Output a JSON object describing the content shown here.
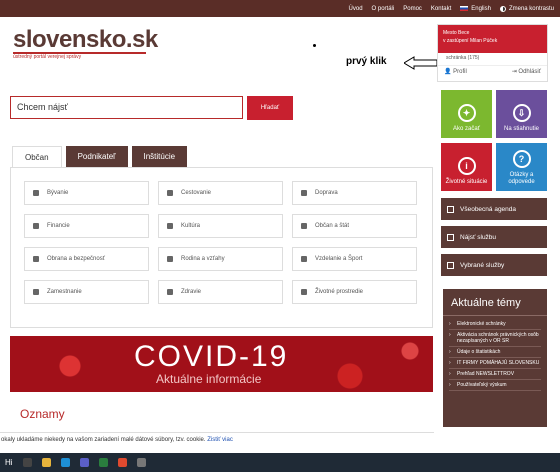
{
  "topbar": {
    "links": [
      "Úvod",
      "O portáli",
      "Pomoc",
      "Kontakt",
      "English",
      "Zmena kontrastu"
    ]
  },
  "logo": {
    "word": "slovensko.sk",
    "tagline": "ústredný portál verejnej správy"
  },
  "annotation": {
    "text": "prvý klik"
  },
  "user": {
    "line1": "Mesto Bece",
    "line2": "v zastúpení Milan Púček",
    "inbox": "schránka (175)",
    "profile": "Profil",
    "logout": "Odhlásiť"
  },
  "search": {
    "placeholder": "Chcem nájsť",
    "button": "Hľadať"
  },
  "tabs": [
    "Občan",
    "Podnikateľ",
    "Inštitúcie"
  ],
  "categories": [
    "Bývanie",
    "Cestovanie",
    "Doprava",
    "Financie",
    "Kultúra",
    "Občan a štát",
    "Obrana a bezpečnosť",
    "Rodina a vzťahy",
    "Vzdelanie a Šport",
    "Zamestnanie",
    "Zdravie",
    "Životné prostredie"
  ],
  "covid": {
    "title": "COVID-19",
    "subtitle": "Aktuálne informácie"
  },
  "oznamy": "Oznamy",
  "tiles": [
    {
      "label": "Ako začať",
      "color": "#7cb82f",
      "glyph": "💡"
    },
    {
      "label": "Na stiahnutie",
      "color": "#6b4f9c",
      "glyph": "⇩"
    },
    {
      "label": "Životné situácie",
      "color": "#c8202f",
      "glyph": "i"
    },
    {
      "label": "Otázky a odpovede",
      "color": "#2a88c8",
      "glyph": "?"
    }
  ],
  "sidebar_buttons": [
    "Všeobecná agenda",
    "Nájsť službu",
    "Vybrané služby"
  ],
  "topics": {
    "title": "Aktuálne témy",
    "items": [
      "Elektronické schránky",
      "Aktivácia schránok právnických osôb nezapísaných v OR SR",
      "Údaje o štatistikách",
      "IT FIRMY POMÁHAJÚ SLOVENSKU",
      "Prehľad NEWSLETTROV",
      "Používateľský výskum"
    ]
  },
  "cookie": {
    "text": "okaly ukladáme niekedy na vašom zariadení malé dátové súbory, tzv. cookie.",
    "link": "Zistiť viac"
  },
  "taskbar": {
    "start": "Hi"
  }
}
